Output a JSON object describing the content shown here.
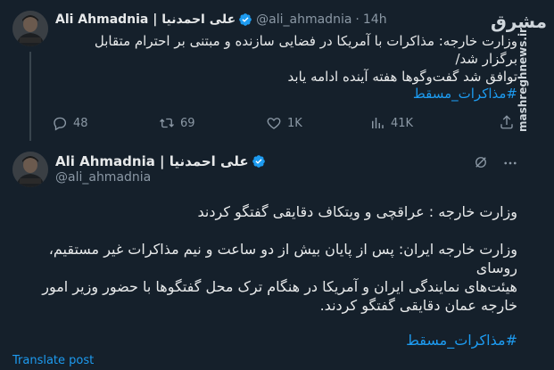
{
  "tweet1": {
    "author_name": "Ali Ahmadnia | علی احمدنیا",
    "handle": "@ali_ahmadnia",
    "separator": "·",
    "time": "14h",
    "text_lines": [
      "وزارت خارجه: مذاکرات با آمریکا در فضایی سازنده و مبتنی بر احترام متقابل برگزار شد/",
      "توافق شد گفت‌وگوها هفته آینده ادامه یابد"
    ],
    "hashtag": "#مذاکرات_مسقط",
    "actions": {
      "replies": "48",
      "reposts": "69",
      "likes": "1K",
      "views": "41K"
    }
  },
  "tweet2": {
    "author_name": "Ali Ahmadnia | علی احمدنیا",
    "handle": "@ali_ahmadnia",
    "paragraph1": "وزارت خارجه : عراقچی و ویتکاف دقایقی گفتگو کردند",
    "paragraph2_lines": [
      "وزارت خارجه ایران: پس از پایان بیش از دو ساعت و نیم مذاکرات غیر مستقیم، روسای",
      "هیئت‌های نمایندگی ایران و آمریکا در هنگام ترک محل گفتگوها با حضور وزیر امور",
      "خارجه عمان دقایقی گفتگو کردند."
    ],
    "hashtag": "#مذاکرات_مسقط",
    "translate_label": "Translate post"
  },
  "watermark": {
    "logo": "مشرق",
    "url": "mashreghnews.ir"
  },
  "colors": {
    "background": "#15202b",
    "text": "#e7e9ea",
    "muted": "#8b98a5",
    "accent": "#1d9bf0"
  },
  "icons": {
    "reply": "reply-icon",
    "repost": "repost-icon",
    "like": "heart-icon",
    "views": "views-icon",
    "share": "share-icon",
    "grok": "grok-icon",
    "more": "more-icon",
    "verified": "verified-badge-icon"
  }
}
